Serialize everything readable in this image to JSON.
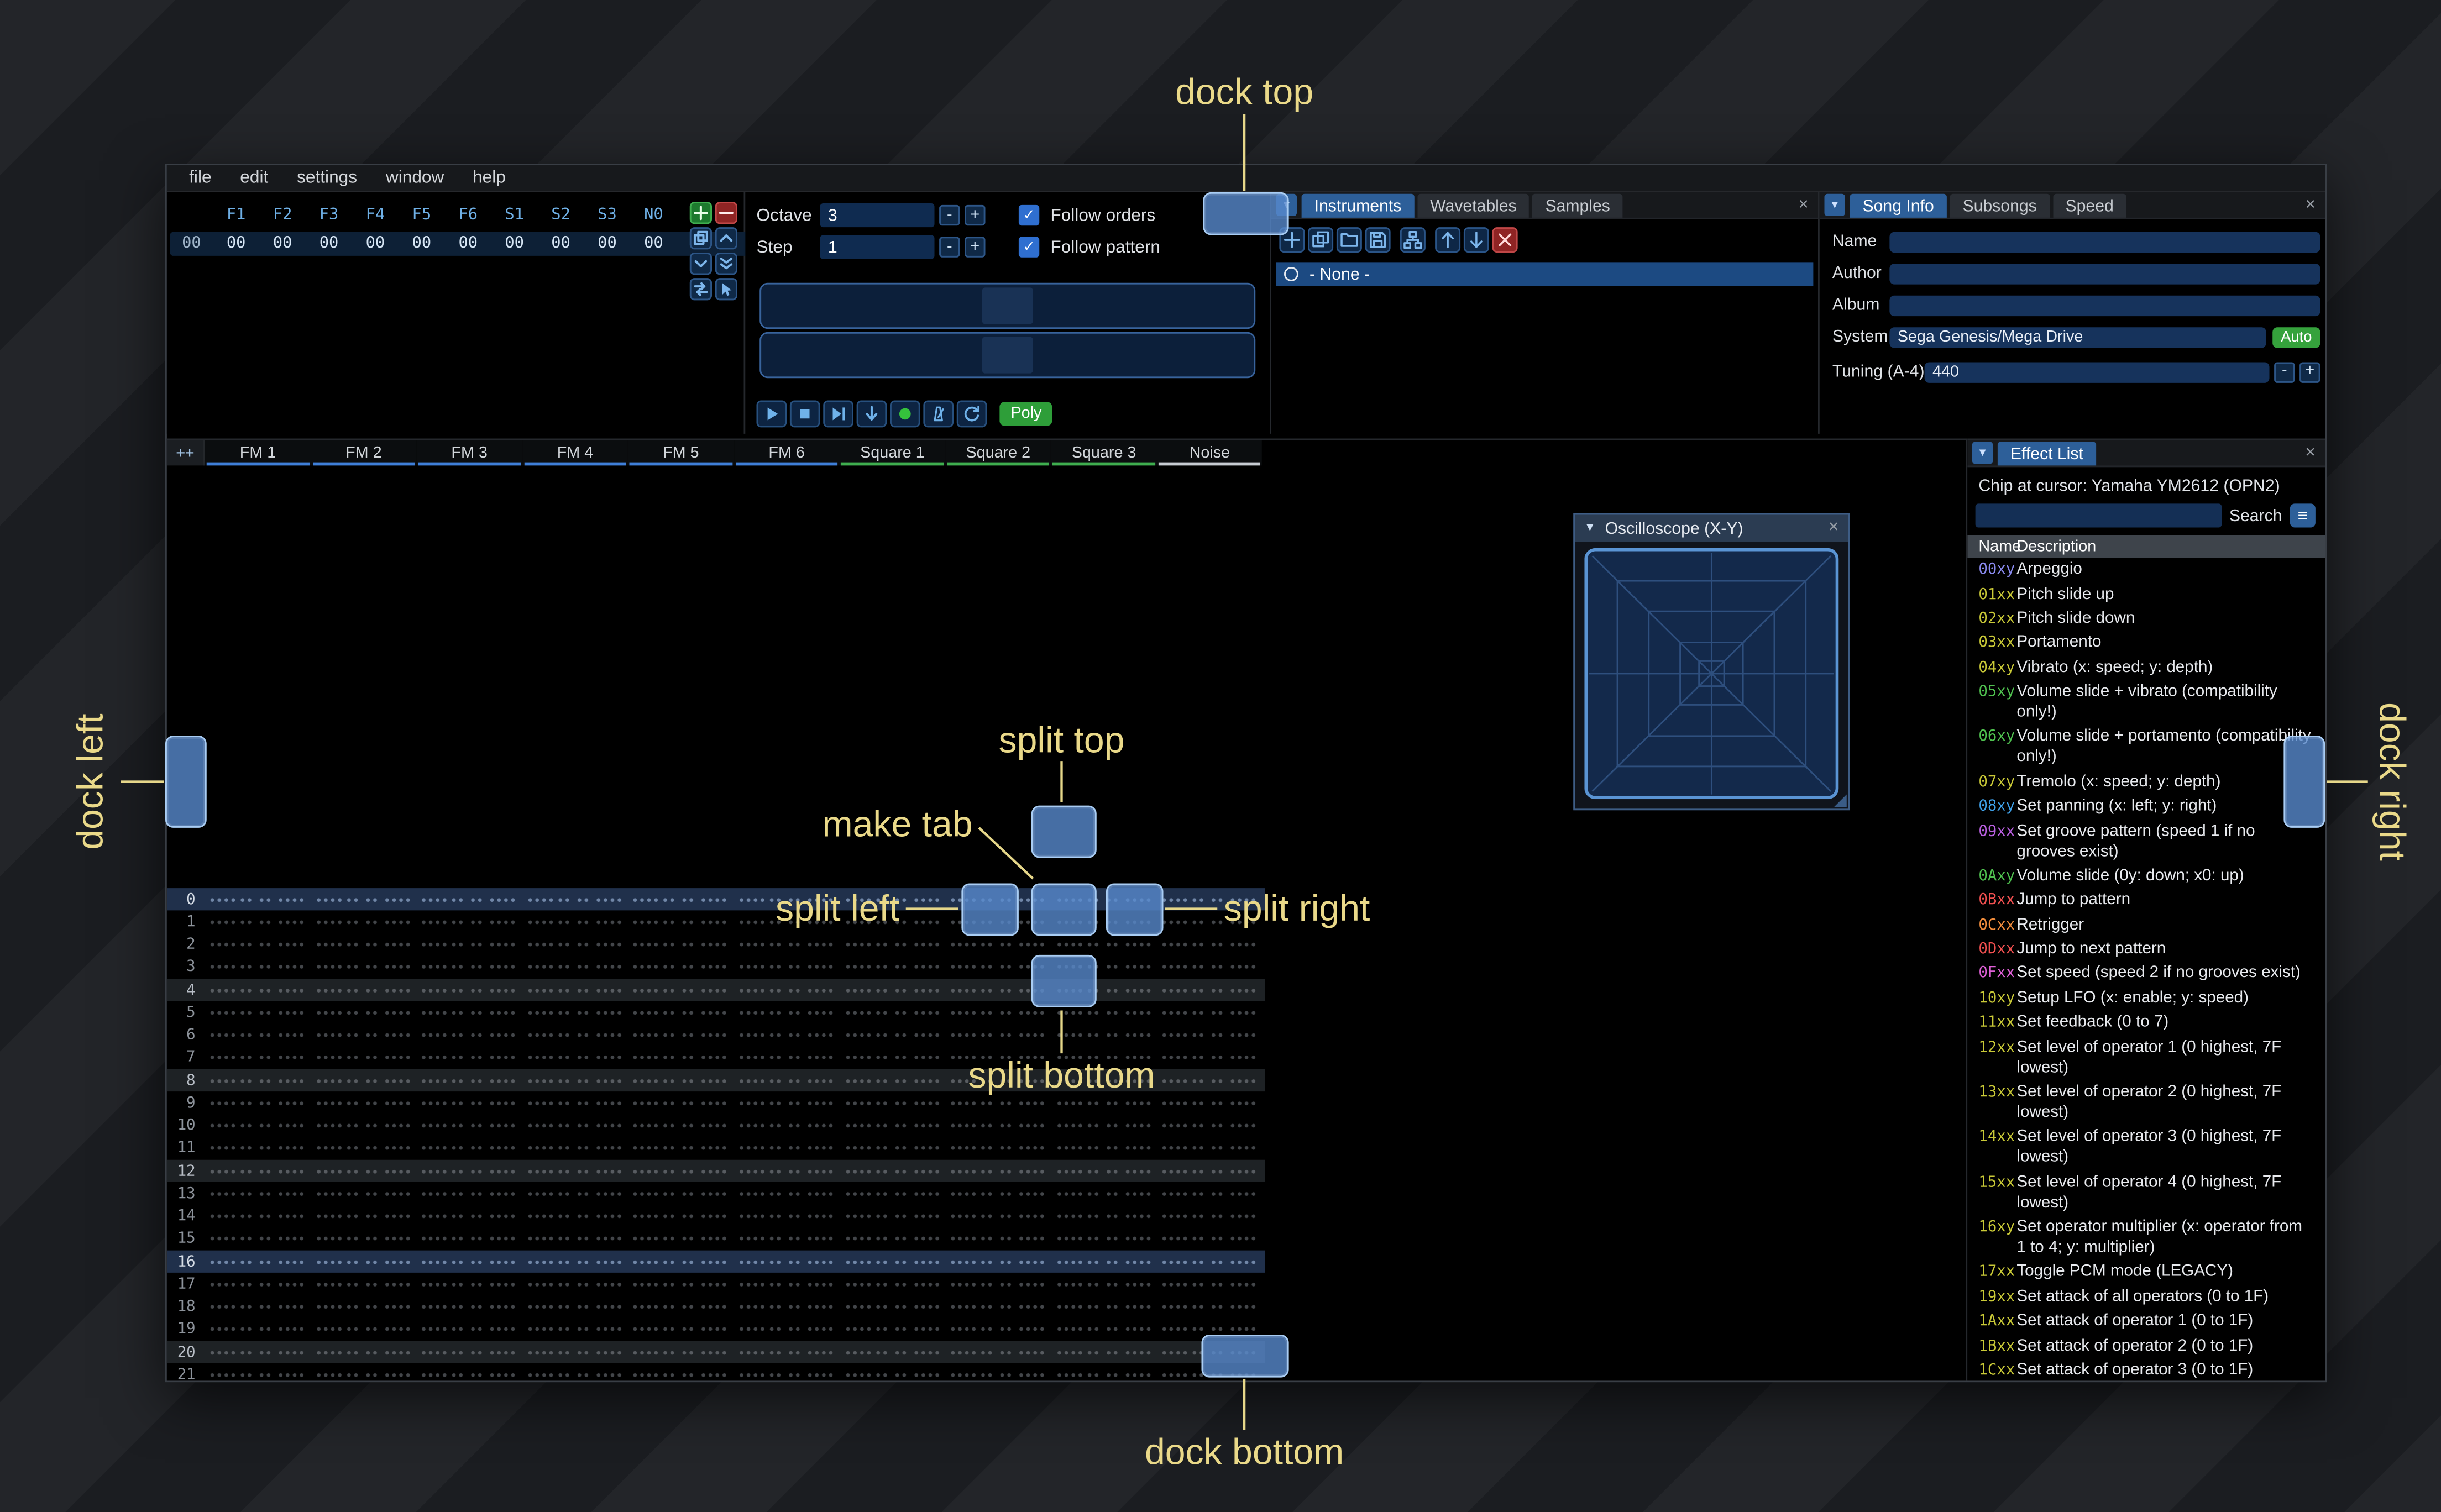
{
  "window": {
    "menu_items": [
      "file",
      "edit",
      "settings",
      "window",
      "help"
    ]
  },
  "orders": {
    "channel_headers": [
      "F1",
      "F2",
      "F3",
      "F4",
      "F5",
      "F6",
      "S1",
      "S2",
      "S3",
      "N0"
    ],
    "row_index": "00",
    "row_values": [
      "00",
      "00",
      "00",
      "00",
      "00",
      "00",
      "00",
      "00",
      "00",
      "00"
    ],
    "button_icons": [
      "add",
      "remove",
      "duplicate",
      "move-up",
      "move-down",
      "move-double-down",
      "exchange",
      "cursor"
    ]
  },
  "controls": {
    "octave_label": "Octave",
    "octave_value": "3",
    "step_label": "Step",
    "step_value": "1",
    "minus": "-",
    "plus": "+",
    "check_glyph": "✓",
    "follow_orders": "Follow orders",
    "follow_pattern": "Follow pattern",
    "transport_icons": [
      "play",
      "stop",
      "play-from-cursor",
      "step-row",
      "record",
      "metronome",
      "repeat"
    ],
    "poly_label": "Poly"
  },
  "instruments": {
    "collapse_glyph": "▼",
    "close_glyph": "×",
    "tabs": [
      {
        "label": "Instruments",
        "selected": true
      },
      {
        "label": "Wavetables",
        "selected": false
      },
      {
        "label": "Samples",
        "selected": false
      }
    ],
    "toolbar_icons": [
      "add",
      "duplicate",
      "open",
      "save",
      "folder-view",
      "move-up",
      "move-down",
      "delete"
    ],
    "list": [
      {
        "label": "- None -",
        "selected": true
      }
    ]
  },
  "song_info": {
    "collapse_glyph": "▼",
    "close_glyph": "×",
    "minus": "-",
    "plus": "+",
    "tabs": [
      {
        "label": "Song Info",
        "selected": true
      },
      {
        "label": "Subsongs",
        "selected": false
      },
      {
        "label": "Speed",
        "selected": false
      }
    ],
    "fields": [
      {
        "label": "Name",
        "value": ""
      },
      {
        "label": "Author",
        "value": ""
      },
      {
        "label": "Album",
        "value": ""
      }
    ],
    "system_label": "System",
    "system_value": "Sega Genesis/Mega Drive",
    "auto_label": "Auto",
    "tuning_label": "Tuning (A-4)",
    "tuning_value": "440"
  },
  "pattern": {
    "corner_label": "++",
    "channels": [
      {
        "name": "FM 1",
        "color": "#3f7fd9"
      },
      {
        "name": "FM 2",
        "color": "#3f7fd9"
      },
      {
        "name": "FM 3",
        "color": "#3f7fd9"
      },
      {
        "name": "FM 4",
        "color": "#3f7fd9"
      },
      {
        "name": "FM 5",
        "color": "#3f7fd9"
      },
      {
        "name": "FM 6",
        "color": "#3f7fd9"
      },
      {
        "name": "Square 1",
        "color": "#3fae4f"
      },
      {
        "name": "Square 2",
        "color": "#3fae4f"
      },
      {
        "name": "Square 3",
        "color": "#3fae4f"
      },
      {
        "name": "Noise",
        "color": "#c7ccd2"
      }
    ],
    "row_count": 22,
    "highlight_every": 4,
    "strong_highlight_every": 16
  },
  "oscilloscope": {
    "title": "Oscilloscope (X-Y)",
    "collapse_glyph": "▼",
    "close_glyph": "×"
  },
  "effect_list": {
    "tab_label": "Effect List",
    "collapse_glyph": "▼",
    "close_glyph": "×",
    "chip_label": "Chip at cursor: Yamaha YM2612 (OPN2)",
    "search_label": "Search",
    "menu_glyph": "≡",
    "columns": [
      "Name",
      "Description"
    ],
    "rows": [
      {
        "code": "00xy",
        "color": "#8a8aef",
        "desc": "Arpeggio"
      },
      {
        "code": "01xx",
        "color": "#c9c937",
        "desc": "Pitch slide up"
      },
      {
        "code": "02xx",
        "color": "#c9c937",
        "desc": "Pitch slide down"
      },
      {
        "code": "03xx",
        "color": "#c9c937",
        "desc": "Portamento"
      },
      {
        "code": "04xy",
        "color": "#c9c937",
        "desc": "Vibrato (x: speed; y: depth)"
      },
      {
        "code": "05xy",
        "color": "#4fc04f",
        "desc": "Volume slide + vibrato (compatibility only!)"
      },
      {
        "code": "06xy",
        "color": "#4fc04f",
        "desc": "Volume slide + portamento (compatibility only!)"
      },
      {
        "code": "07xy",
        "color": "#c9c937",
        "desc": "Tremolo (x: speed; y: depth)"
      },
      {
        "code": "08xy",
        "color": "#3fa0e8",
        "desc": "Set panning (x: left; y: right)"
      },
      {
        "code": "09xx",
        "color": "#b95fe0",
        "desc": "Set groove pattern (speed 1 if no grooves exist)"
      },
      {
        "code": "0Axy",
        "color": "#4fc04f",
        "desc": "Volume slide (0y: down; x0: up)"
      },
      {
        "code": "0Bxx",
        "color": "#f25050",
        "desc": "Jump to pattern"
      },
      {
        "code": "0Cxx",
        "color": "#f08c3c",
        "desc": "Retrigger"
      },
      {
        "code": "0Dxx",
        "color": "#f25050",
        "desc": "Jump to next pattern"
      },
      {
        "code": "0Fxx",
        "color": "#e060d8",
        "desc": "Set speed (speed 2 if no grooves exist)"
      },
      {
        "code": "10xy",
        "color": "#c9c937",
        "desc": "Setup LFO (x: enable; y: speed)"
      },
      {
        "code": "11xx",
        "color": "#c9c937",
        "desc": "Set feedback (0 to 7)"
      },
      {
        "code": "12xx",
        "color": "#c9c937",
        "desc": "Set level of operator 1 (0 highest, 7F lowest)"
      },
      {
        "code": "13xx",
        "color": "#c9c937",
        "desc": "Set level of operator 2 (0 highest, 7F lowest)"
      },
      {
        "code": "14xx",
        "color": "#c9c937",
        "desc": "Set level of operator 3 (0 highest, 7F lowest)"
      },
      {
        "code": "15xx",
        "color": "#c9c937",
        "desc": "Set level of operator 4 (0 highest, 7F lowest)"
      },
      {
        "code": "16xy",
        "color": "#c9c937",
        "desc": "Set operator multiplier (x: operator from 1 to 4; y: multiplier)"
      },
      {
        "code": "17xx",
        "color": "#c9c937",
        "desc": "Toggle PCM mode (LEGACY)"
      },
      {
        "code": "19xx",
        "color": "#c9c937",
        "desc": "Set attack of all operators (0 to 1F)"
      },
      {
        "code": "1Axx",
        "color": "#c9c937",
        "desc": "Set attack of operator 1 (0 to 1F)"
      },
      {
        "code": "1Bxx",
        "color": "#c9c937",
        "desc": "Set attack of operator 2 (0 to 1F)"
      },
      {
        "code": "1Cxx",
        "color": "#c9c937",
        "desc": "Set attack of operator 3 (0 to 1F)"
      }
    ]
  },
  "dock_overlay": {
    "top": "dock top",
    "bottom": "dock bottom",
    "left": "dock left",
    "right": "dock right",
    "split_top": "split top",
    "split_bottom": "split bottom",
    "split_left": "split left",
    "split_right": "split right",
    "make_tab": "make tab"
  }
}
